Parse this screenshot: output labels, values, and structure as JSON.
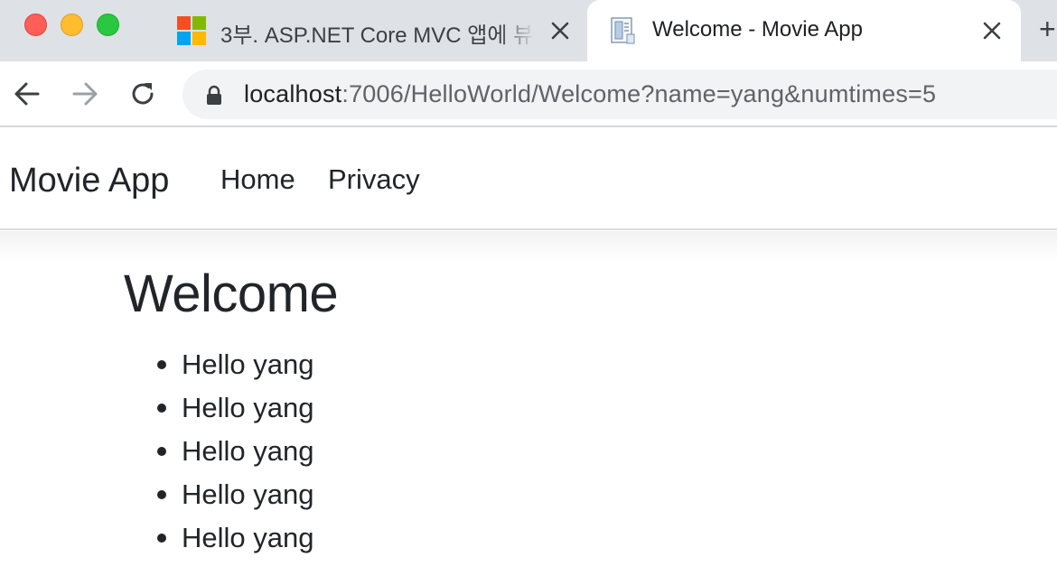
{
  "browser": {
    "tabs": [
      {
        "title": "3부. ASP.NET Core MVC 앱에 뷰",
        "active": false,
        "favicon": "microsoft-logo-icon"
      },
      {
        "title": "Welcome - Movie App",
        "active": true,
        "favicon": "document-icon"
      }
    ],
    "address_bar": {
      "host": "localhost",
      "path": ":7006/HelloWorld/Welcome?name=yang&numtimes=5"
    }
  },
  "site": {
    "brand": "Movie App",
    "nav_links": [
      "Home",
      "Privacy"
    ]
  },
  "main": {
    "heading": "Welcome",
    "greetings": [
      "Hello yang",
      "Hello yang",
      "Hello yang",
      "Hello yang",
      "Hello yang"
    ]
  },
  "colors": {
    "tabbar_bg": "#dee1e6",
    "omnibox_bg": "#f1f3f4",
    "text": "#212529",
    "traffic_red": "#ff5f57",
    "traffic_yellow": "#febc2e",
    "traffic_green": "#28c840",
    "ms_red": "#f25022",
    "ms_green": "#7fba00",
    "ms_blue": "#00a4ef",
    "ms_yellow": "#ffb900"
  }
}
